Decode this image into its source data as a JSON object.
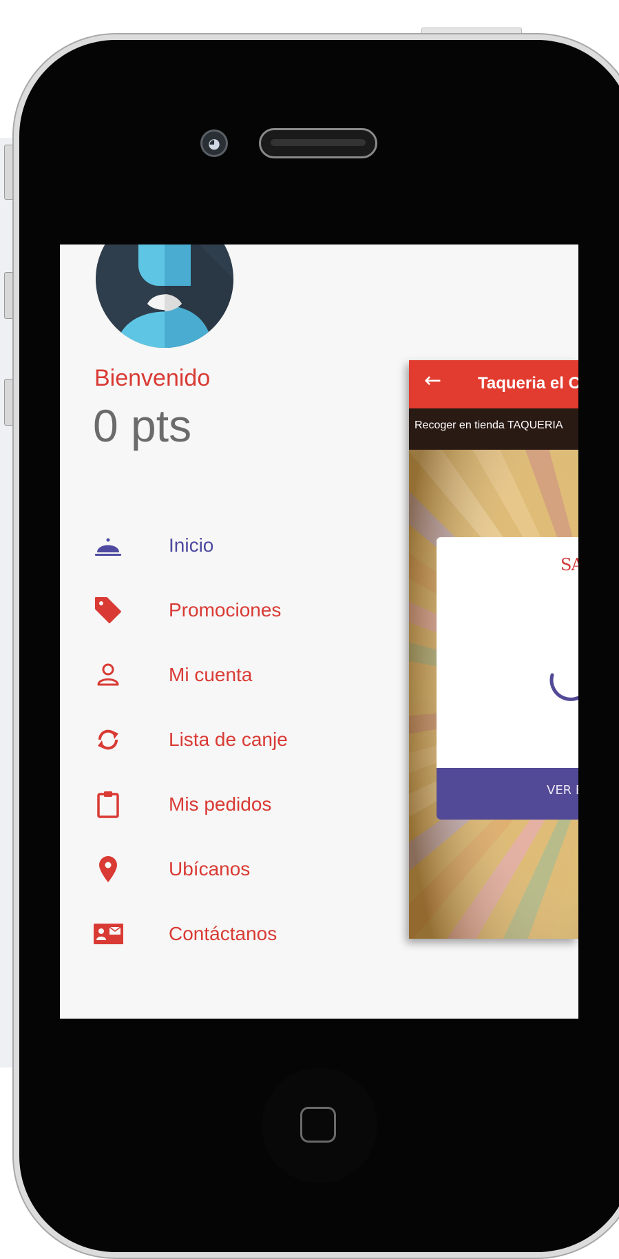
{
  "drawer": {
    "welcome": "Bienvenido",
    "points": "0 pts",
    "items": [
      {
        "label": "Inicio",
        "icon": "cloche-icon"
      },
      {
        "label": "Promociones",
        "icon": "tag-icon"
      },
      {
        "label": "Mi cuenta",
        "icon": "user-icon"
      },
      {
        "label": "Lista de canje",
        "icon": "sync-icon"
      },
      {
        "label": "Mis pedidos",
        "icon": "clipboard-icon"
      },
      {
        "label": "Ubícanos",
        "icon": "location-pin-icon"
      },
      {
        "label": "Contáctanos",
        "icon": "contact-card-icon"
      }
    ]
  },
  "app_preview": {
    "title": "Taqueria el C",
    "pickup": "Recoger en tienda TAQUERIA",
    "promo_heading": "SAL",
    "promo_footer": "VER EL"
  },
  "colors": {
    "accent_red": "#d93a34",
    "accent_purple": "#4f4aa0",
    "app_bar_red": "#e23b2f",
    "promo_footer_purple": "#524a96",
    "points_gray": "#6b6b6b"
  }
}
